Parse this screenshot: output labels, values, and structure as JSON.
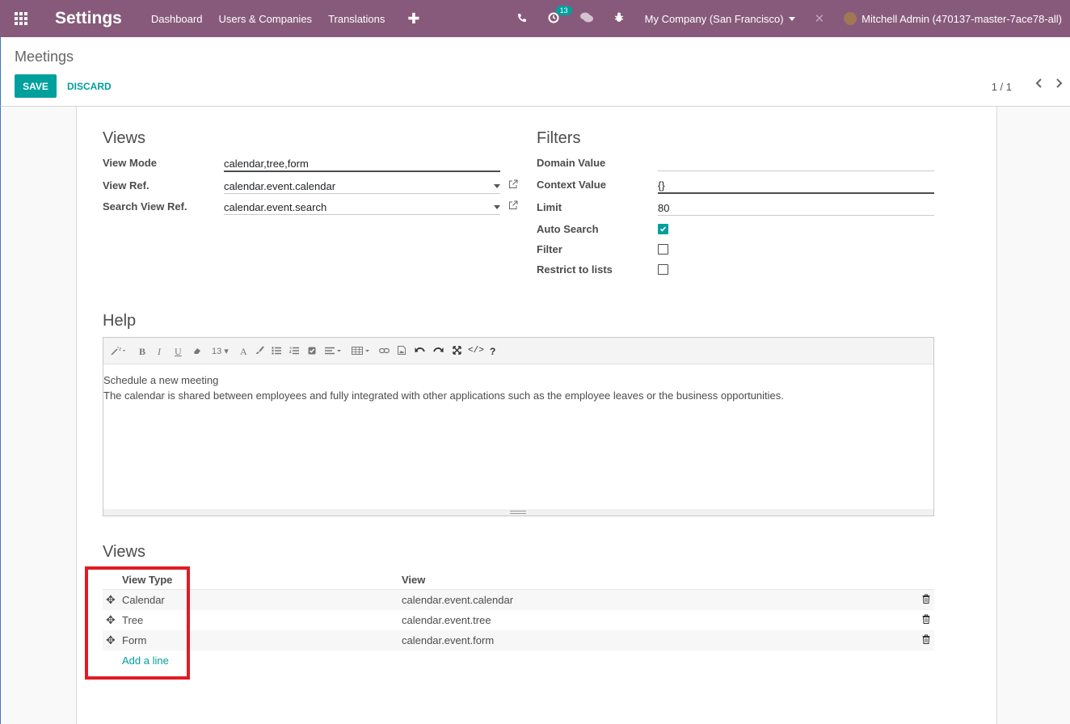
{
  "navbar": {
    "brand": "Settings",
    "menu": [
      "Dashboard",
      "Users & Companies",
      "Translations"
    ],
    "plus": "✚",
    "activity_count": "13",
    "company": "My Company (San Francisco)",
    "user": "Mitchell Admin (470137-master-7ace78-all)"
  },
  "control_panel": {
    "breadcrumb": "Meetings",
    "save_label": "SAVE",
    "discard_label": "DISCARD",
    "pager": "1 / 1"
  },
  "views_group": {
    "title": "Views",
    "view_mode_label": "View Mode",
    "view_mode_value": "calendar,tree,form",
    "view_ref_label": "View Ref.",
    "view_ref_value": "calendar.event.calendar",
    "search_view_ref_label": "Search View Ref.",
    "search_view_ref_value": "calendar.event.search"
  },
  "filters_group": {
    "title": "Filters",
    "domain_label": "Domain Value",
    "domain_value": "",
    "context_label": "Context Value",
    "context_value": "{}",
    "limit_label": "Limit",
    "limit_value": "80",
    "auto_search_label": "Auto Search",
    "auto_search_checked": true,
    "filter_label": "Filter",
    "filter_checked": false,
    "restrict_label": "Restrict to lists",
    "restrict_checked": false
  },
  "help": {
    "title": "Help",
    "font_size": "13",
    "line1": "Schedule a new meeting",
    "line2": "The calendar is shared between employees and fully integrated with other applications such as the employee leaves or the business opportunities."
  },
  "views_table": {
    "title": "Views",
    "col_type": "View Type",
    "col_view": "View",
    "rows": [
      {
        "type": "Calendar",
        "view": "calendar.event.calendar"
      },
      {
        "type": "Tree",
        "view": "calendar.event.tree"
      },
      {
        "type": "Form",
        "view": "calendar.event.form"
      }
    ],
    "add_line": "Add a line"
  },
  "colors": {
    "navbar": "#875a7b",
    "primary": "#00a09d",
    "highlight": "#e01b24"
  }
}
